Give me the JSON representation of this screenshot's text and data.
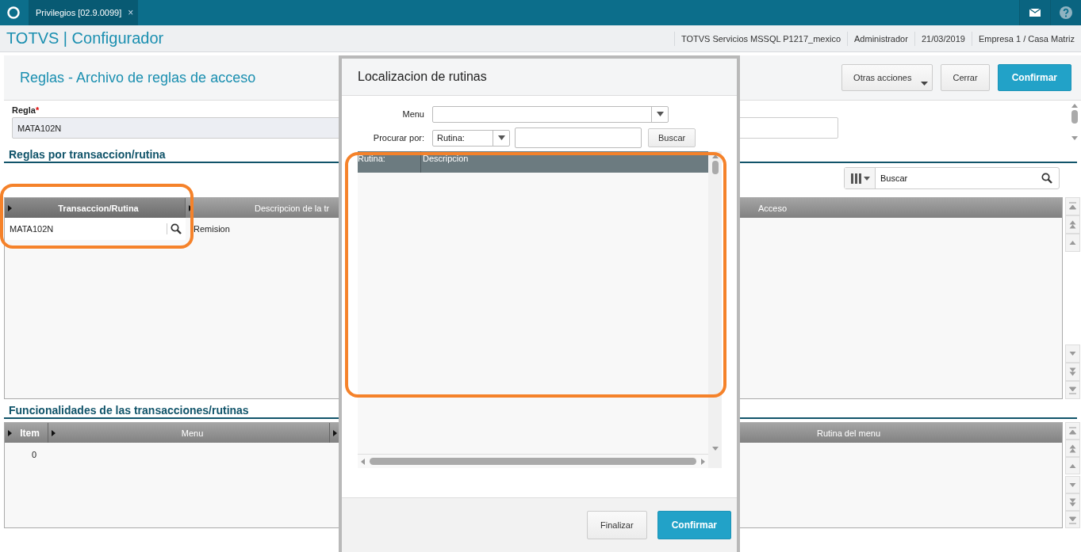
{
  "topbar": {
    "tab": {
      "label": "Privilegios [02.9.0099]",
      "close": "×",
      "selected": true
    }
  },
  "header": {
    "app_title": "TOTVS | Configurador",
    "info": [
      "TOTVS Servicios MSSQL P1217_mexico",
      "Administrador",
      "21/03/2019",
      "Empresa 1 / Casa Matriz"
    ]
  },
  "page": {
    "title": "Reglas - Archivo de reglas de acceso",
    "buttons": [
      {
        "label": "Otras acciones",
        "kind": "menu"
      },
      {
        "label": "Cerrar",
        "kind": "default"
      },
      {
        "label": "Confirmar",
        "kind": "primary"
      }
    ]
  },
  "form": {
    "label": "Regla",
    "required": true,
    "required_mark": "*",
    "value": "MATA102N"
  },
  "rules_section": {
    "title": "Reglas por transaccion/rutina",
    "search": {
      "value": "Buscar"
    },
    "columns": [
      "Transaccion/Rutina",
      "Descripcion de la tr",
      "Acceso"
    ],
    "rows": [
      {
        "cells": [
          "MATA102N",
          "Remision"
        ]
      }
    ]
  },
  "functions_section": {
    "title": "Funcionalidades de las transacciones/rutinas",
    "columns": [
      "Item",
      "Menu",
      "Rutina del menu"
    ],
    "rows": [
      {
        "cells": [
          "0"
        ]
      }
    ]
  },
  "dialog": {
    "title": "Localizacion de rutinas",
    "menu_label": "Menu",
    "search_by_label": "Procurar por:",
    "search_by_value": "Rutina:",
    "search_button": "Buscar",
    "columns": [
      "Rutina:",
      "Descripcion"
    ],
    "buttons": [
      {
        "label": "Finalizar",
        "kind": "default"
      },
      {
        "label": "Confirmar",
        "kind": "primary"
      }
    ]
  }
}
